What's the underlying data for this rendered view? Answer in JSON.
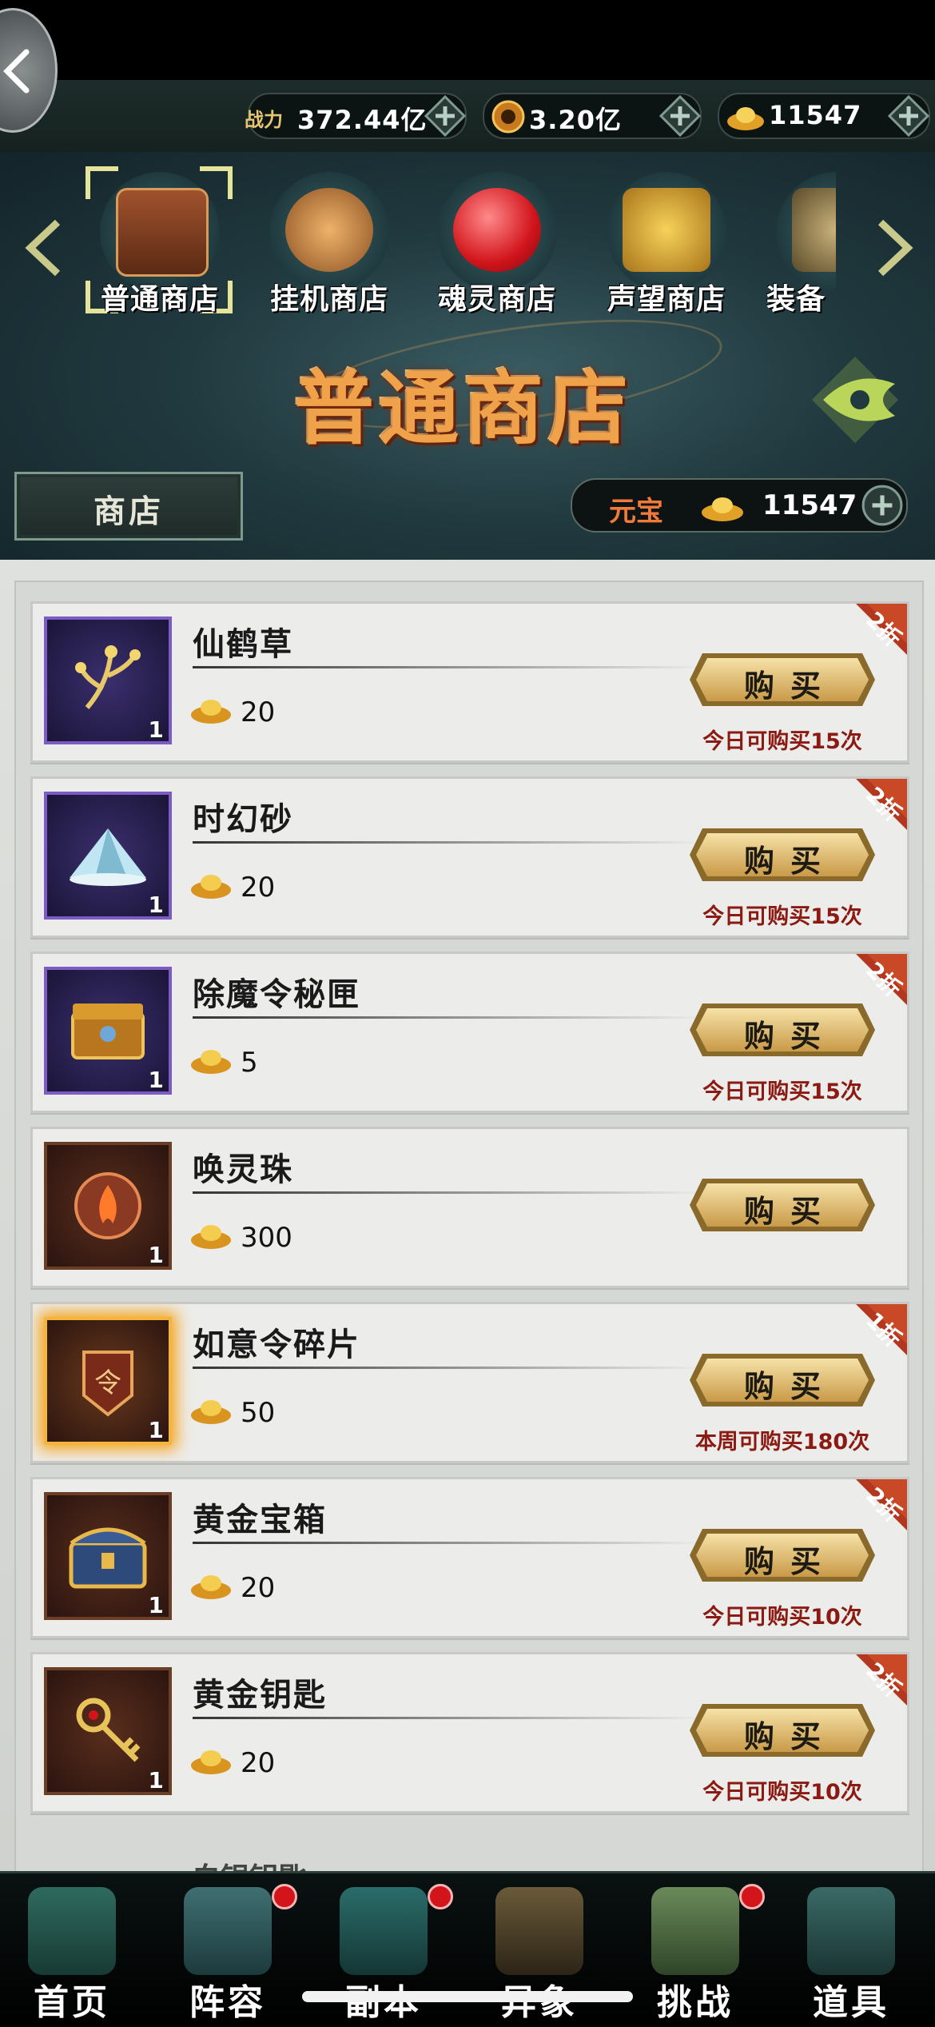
{
  "resources": {
    "power_label": "战力",
    "power": "372.44亿",
    "coins": "3.20亿",
    "ingots": "11547"
  },
  "shop_tabs": [
    {
      "label": "普通商店"
    },
    {
      "label": "挂机商店"
    },
    {
      "label": "魂灵商店"
    },
    {
      "label": "声望商店"
    },
    {
      "label": "装备"
    }
  ],
  "banner_title": "普通商店",
  "shop_button": "商店",
  "currency_bar": {
    "label": "元宝",
    "value": "11547"
  },
  "buy_label": "购买",
  "items": [
    {
      "name": "仙鹤草",
      "qty": "1",
      "price": "20",
      "limit": "今日可购买15次",
      "discount": "2折",
      "frame": "purple"
    },
    {
      "name": "时幻砂",
      "qty": "1",
      "price": "20",
      "limit": "今日可购买15次",
      "discount": "2折",
      "frame": "purple"
    },
    {
      "name": "除魔令秘匣",
      "qty": "1",
      "price": "5",
      "limit": "今日可购买15次",
      "discount": "2折",
      "frame": "purple"
    },
    {
      "name": "唤灵珠",
      "qty": "1",
      "price": "300",
      "limit": "",
      "discount": "",
      "frame": "brown"
    },
    {
      "name": "如意令碎片",
      "qty": "1",
      "price": "50",
      "limit": "本周可购买180次",
      "discount": "1折",
      "frame": "gold"
    },
    {
      "name": "黄金宝箱",
      "qty": "1",
      "price": "20",
      "limit": "今日可购买10次",
      "discount": "2折",
      "frame": "brown"
    },
    {
      "name": "黄金钥匙",
      "qty": "1",
      "price": "20",
      "limit": "今日可购买10次",
      "discount": "2折",
      "frame": "brown"
    }
  ],
  "peek_item": "白银钥匙",
  "nav": [
    {
      "label": "首页",
      "badge": false
    },
    {
      "label": "阵容",
      "badge": true
    },
    {
      "label": "副本",
      "badge": true
    },
    {
      "label": "异象",
      "badge": false
    },
    {
      "label": "挑战",
      "badge": true
    },
    {
      "label": "道具",
      "badge": false
    }
  ],
  "colors": {
    "accent_gold": "#e7c673",
    "limit_red": "#8a1a12",
    "purple_frame": "#7c5bc4"
  }
}
